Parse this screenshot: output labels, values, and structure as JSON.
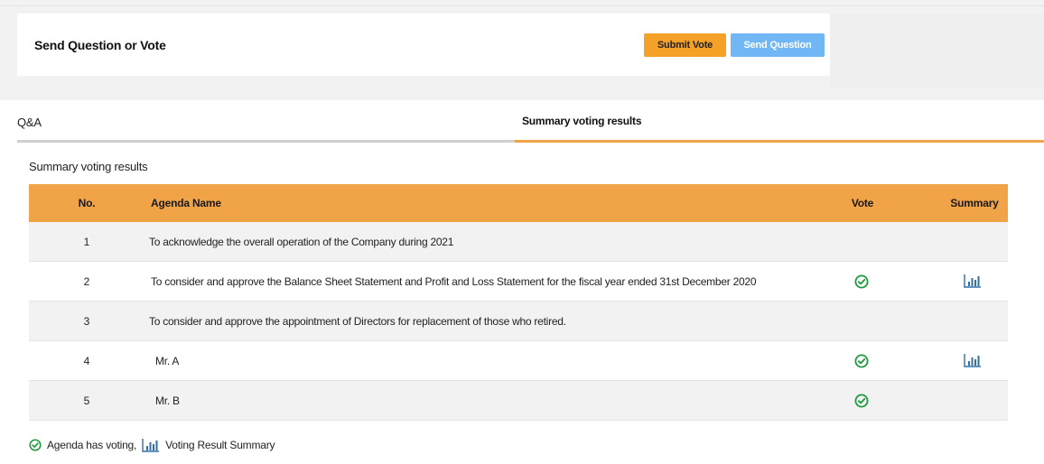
{
  "header": {
    "title": "Send Question or Vote",
    "submit_vote_label": "Submit Vote",
    "send_question_label": "Send Question"
  },
  "tabs": [
    {
      "label": "Q&A",
      "active": false
    },
    {
      "label": "Summary voting results",
      "active": true
    }
  ],
  "section_title": "Summary voting results",
  "table": {
    "columns": [
      "No.",
      "Agenda Name",
      "Vote",
      "Summary"
    ],
    "rows": [
      {
        "no": "1",
        "agenda": "To acknowledge the overall operation of the Company during 2021",
        "voted": false,
        "summary": false
      },
      {
        "no": "2",
        "agenda": "To consider and approve the Balance Sheet Statement and Profit and Loss Statement for the fiscal year ended 31st December 2020",
        "voted": true,
        "summary": true
      },
      {
        "no": "3",
        "agenda": "To consider and approve the appointment of Directors for replacement of those who retired.",
        "voted": false,
        "summary": false
      },
      {
        "no": "4",
        "agenda": "Mr. A",
        "voted": true,
        "summary": true
      },
      {
        "no": "5",
        "agenda": "Mr. B",
        "voted": true,
        "summary": false
      }
    ]
  },
  "legend": {
    "voting_label": "Agenda has voting,",
    "summary_label": "Voting Result Summary"
  },
  "icons": {
    "vote": "check-circle-icon",
    "summary": "bar-chart-icon"
  },
  "colors": {
    "accent_orange": "#f0a347",
    "submit_button": "#f5a128",
    "send_question_button": "#72b7f5",
    "check_green": "#1e9b3c",
    "chart_blue": "#2f6ea8"
  }
}
